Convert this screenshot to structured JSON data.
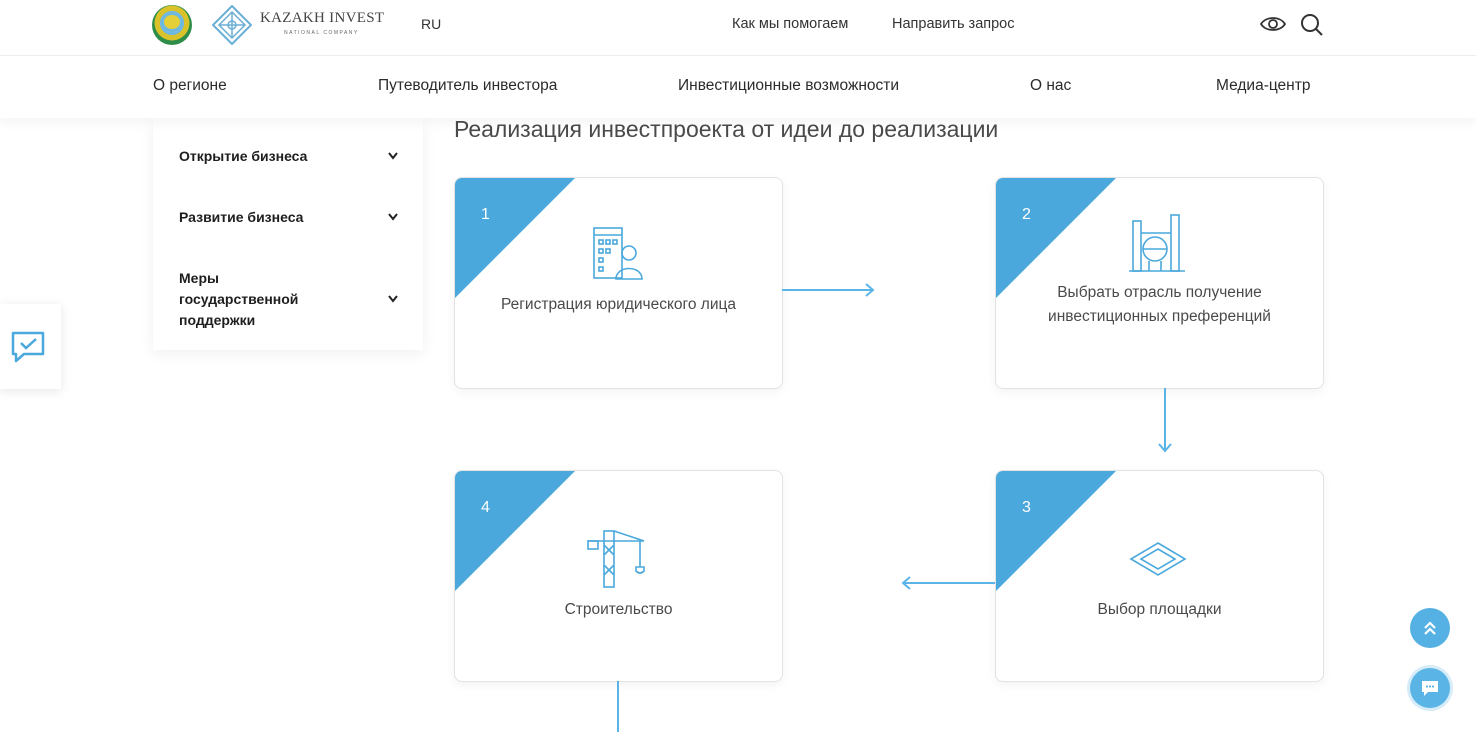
{
  "header": {
    "brand_name": "KAZAKH INVEST",
    "brand_sub": "NATIONAL COMPANY",
    "lang": "RU",
    "links": [
      "Как мы помогаем",
      "Направить запрос"
    ],
    "icons": [
      "eye-icon",
      "search-icon"
    ]
  },
  "nav": {
    "items": [
      "О регионе",
      "Путеводитель инвестора",
      "Инвестиционные возможности",
      "О нас",
      "Медиа-центр"
    ]
  },
  "sidebar": {
    "items": [
      {
        "label": "Открытие бизнеса"
      },
      {
        "label": "Развитие бизнеса"
      },
      {
        "label": "Меры государственной поддержки"
      }
    ]
  },
  "main": {
    "title": "Реализация инвестпроекта от идеи до реализации",
    "steps": [
      {
        "number": "1",
        "label": "Регистрация юридического лица",
        "icon": "building-user-icon"
      },
      {
        "number": "2",
        "label": "Выбрать отрасль получение инвестиционных преференций",
        "icon": "factory-icon"
      },
      {
        "number": "3",
        "label": "Выбор площадки",
        "icon": "land-plot-icon"
      },
      {
        "number": "4",
        "label": "Строительство",
        "icon": "crane-icon"
      }
    ]
  },
  "colors": {
    "accent": "#4aa8dc",
    "arrow": "#5ab4e6"
  }
}
